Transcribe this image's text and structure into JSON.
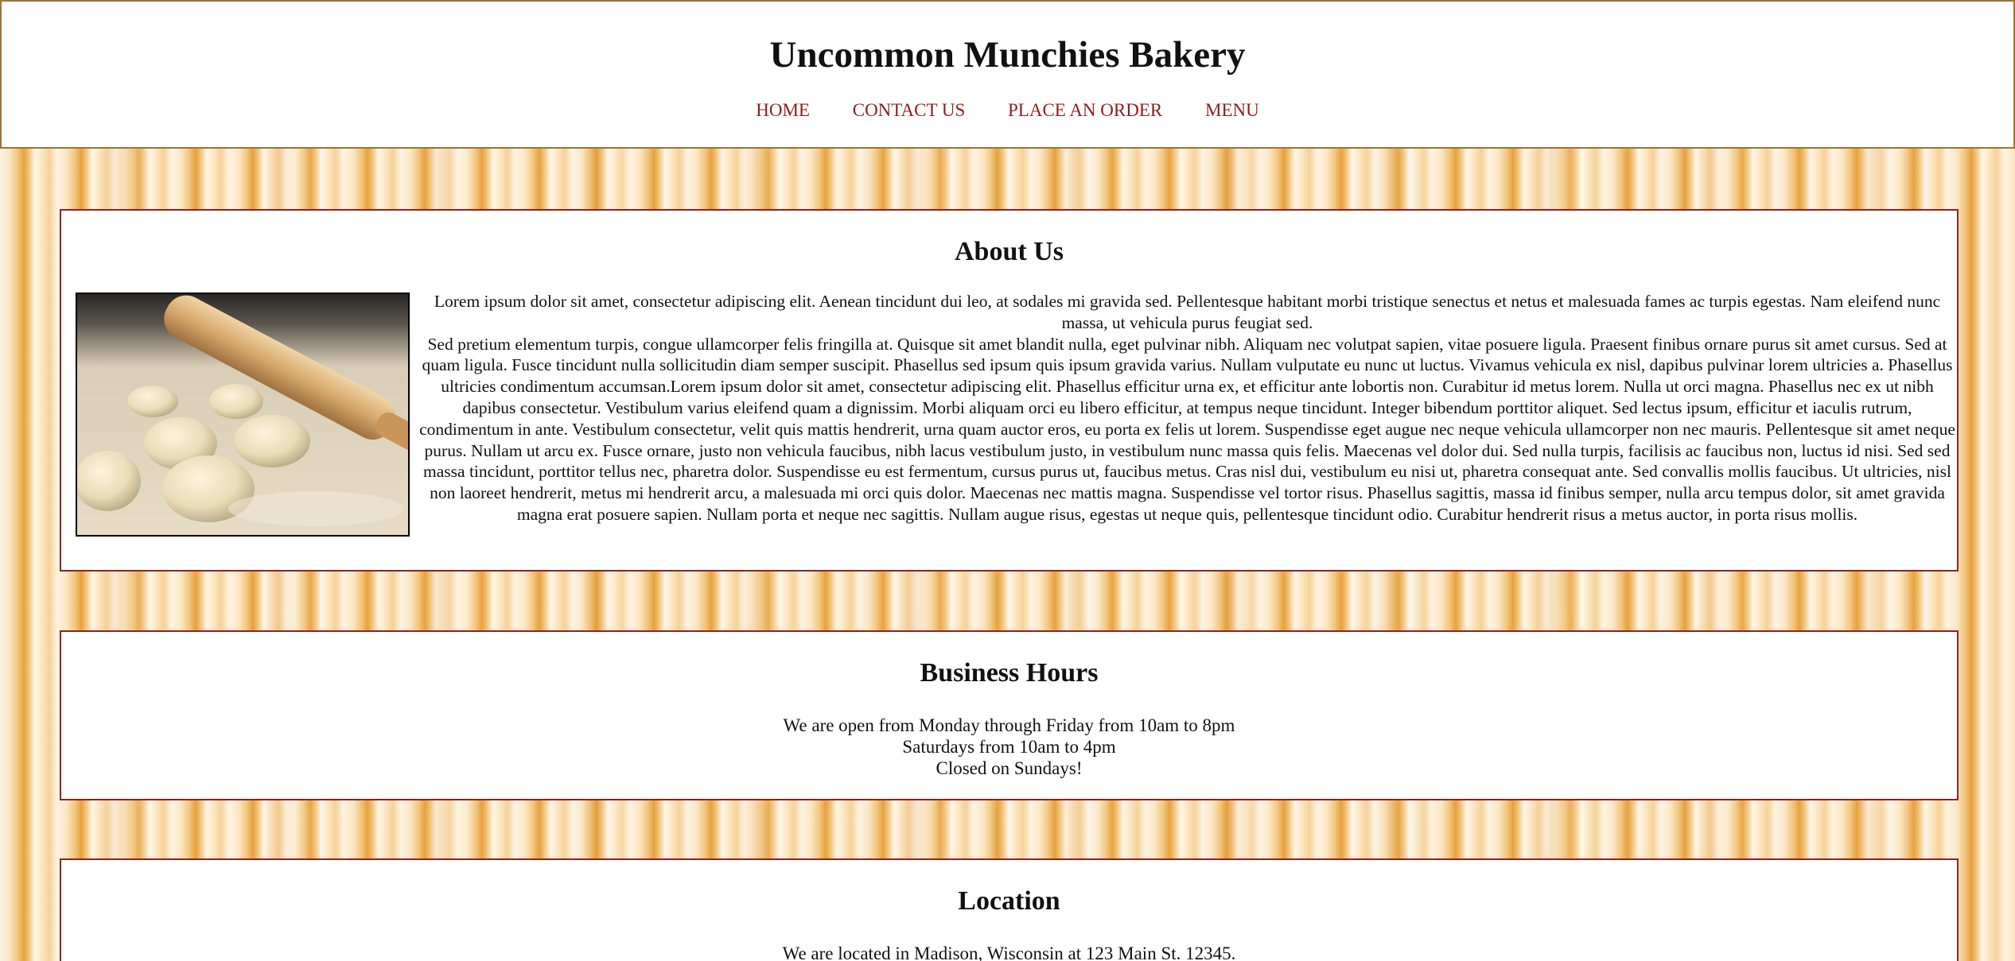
{
  "site": {
    "title": "Uncommon Munchies Bakery"
  },
  "nav": {
    "items": [
      "HOME",
      "CONTACT US",
      "PLACE AN ORDER",
      "MENU"
    ],
    "link_color": "#8f1c1c"
  },
  "about": {
    "heading": "About Us",
    "image_icon": "dough-rolling-pin-photo",
    "paragraphs": [
      "Lorem ipsum dolor sit amet, consectetur adipiscing elit. Aenean tincidunt dui leo, at sodales mi gravida sed. Pellentesque habitant morbi tristique senectus et netus et malesuada fames ac turpis egestas. Nam eleifend nunc massa, ut vehicula purus feugiat sed.",
      "Sed pretium elementum turpis, congue ullamcorper felis fringilla at. Quisque sit amet blandit nulla, eget pulvinar nibh. Aliquam nec volutpat sapien, vitae posuere ligula. Praesent finibus ornare purus sit amet cursus. Sed at quam ligula. Fusce tincidunt nulla sollicitudin diam semper suscipit. Phasellus sed ipsum quis ipsum gravida varius. Nullam vulputate eu nunc ut luctus. Vivamus vehicula ex nisl, dapibus pulvinar lorem ultricies a. Phasellus ultricies condimentum accumsan.Lorem ipsum dolor sit amet, consectetur adipiscing elit. Phasellus efficitur urna ex, et efficitur ante lobortis non. Curabitur id metus lorem. Nulla ut orci magna. Phasellus nec ex ut nibh dapibus consectetur. Vestibulum varius eleifend quam a dignissim. Morbi aliquam orci eu libero efficitur, at tempus neque tincidunt. Integer bibendum porttitor aliquet. Sed lectus ipsum, efficitur et iaculis rutrum, condimentum in ante. Vestibulum consectetur, velit quis mattis hendrerit, urna quam auctor eros, eu porta ex felis ut lorem. Suspendisse eget augue nec neque vehicula ullamcorper non nec mauris. Pellentesque sit amet neque purus. Nullam ut arcu ex. Fusce ornare, justo non vehicula faucibus, nibh lacus vestibulum justo, in vestibulum nunc massa quis felis. Maecenas vel dolor dui. Sed nulla turpis, facilisis ac faucibus non, luctus id nisi. Sed sed massa tincidunt, porttitor tellus nec, pharetra dolor. Suspendisse eu est fermentum, cursus purus ut, faucibus metus. Cras nisl dui, vestibulum eu nisi ut, pharetra consequat ante. Sed convallis mollis faucibus. Ut ultricies, nisl non laoreet hendrerit, metus mi hendrerit arcu, a malesuada mi orci quis dolor. Maecenas nec mattis magna. Suspendisse vel tortor risus. Phasellus sagittis, massa id finibus semper, nulla arcu tempus dolor, sit amet gravida magna erat posuere sapien. Nullam porta et neque nec sagittis. Nullam augue risus, egestas ut neque quis, pellentesque tincidunt odio. Curabitur hendrerit risus a metus auctor, in porta risus mollis."
    ]
  },
  "hours": {
    "heading": "Business Hours",
    "lines": [
      "We are open from Monday through Friday from 10am to 8pm",
      "Saturdays from 10am to 4pm",
      "Closed on Sundays!"
    ]
  },
  "location": {
    "heading": "Location",
    "line": "We are located in Madison, Wisconsin at 123 Main St. 12345."
  },
  "colors": {
    "panel_border": "#8a2424",
    "header_border": "#9b7339"
  }
}
